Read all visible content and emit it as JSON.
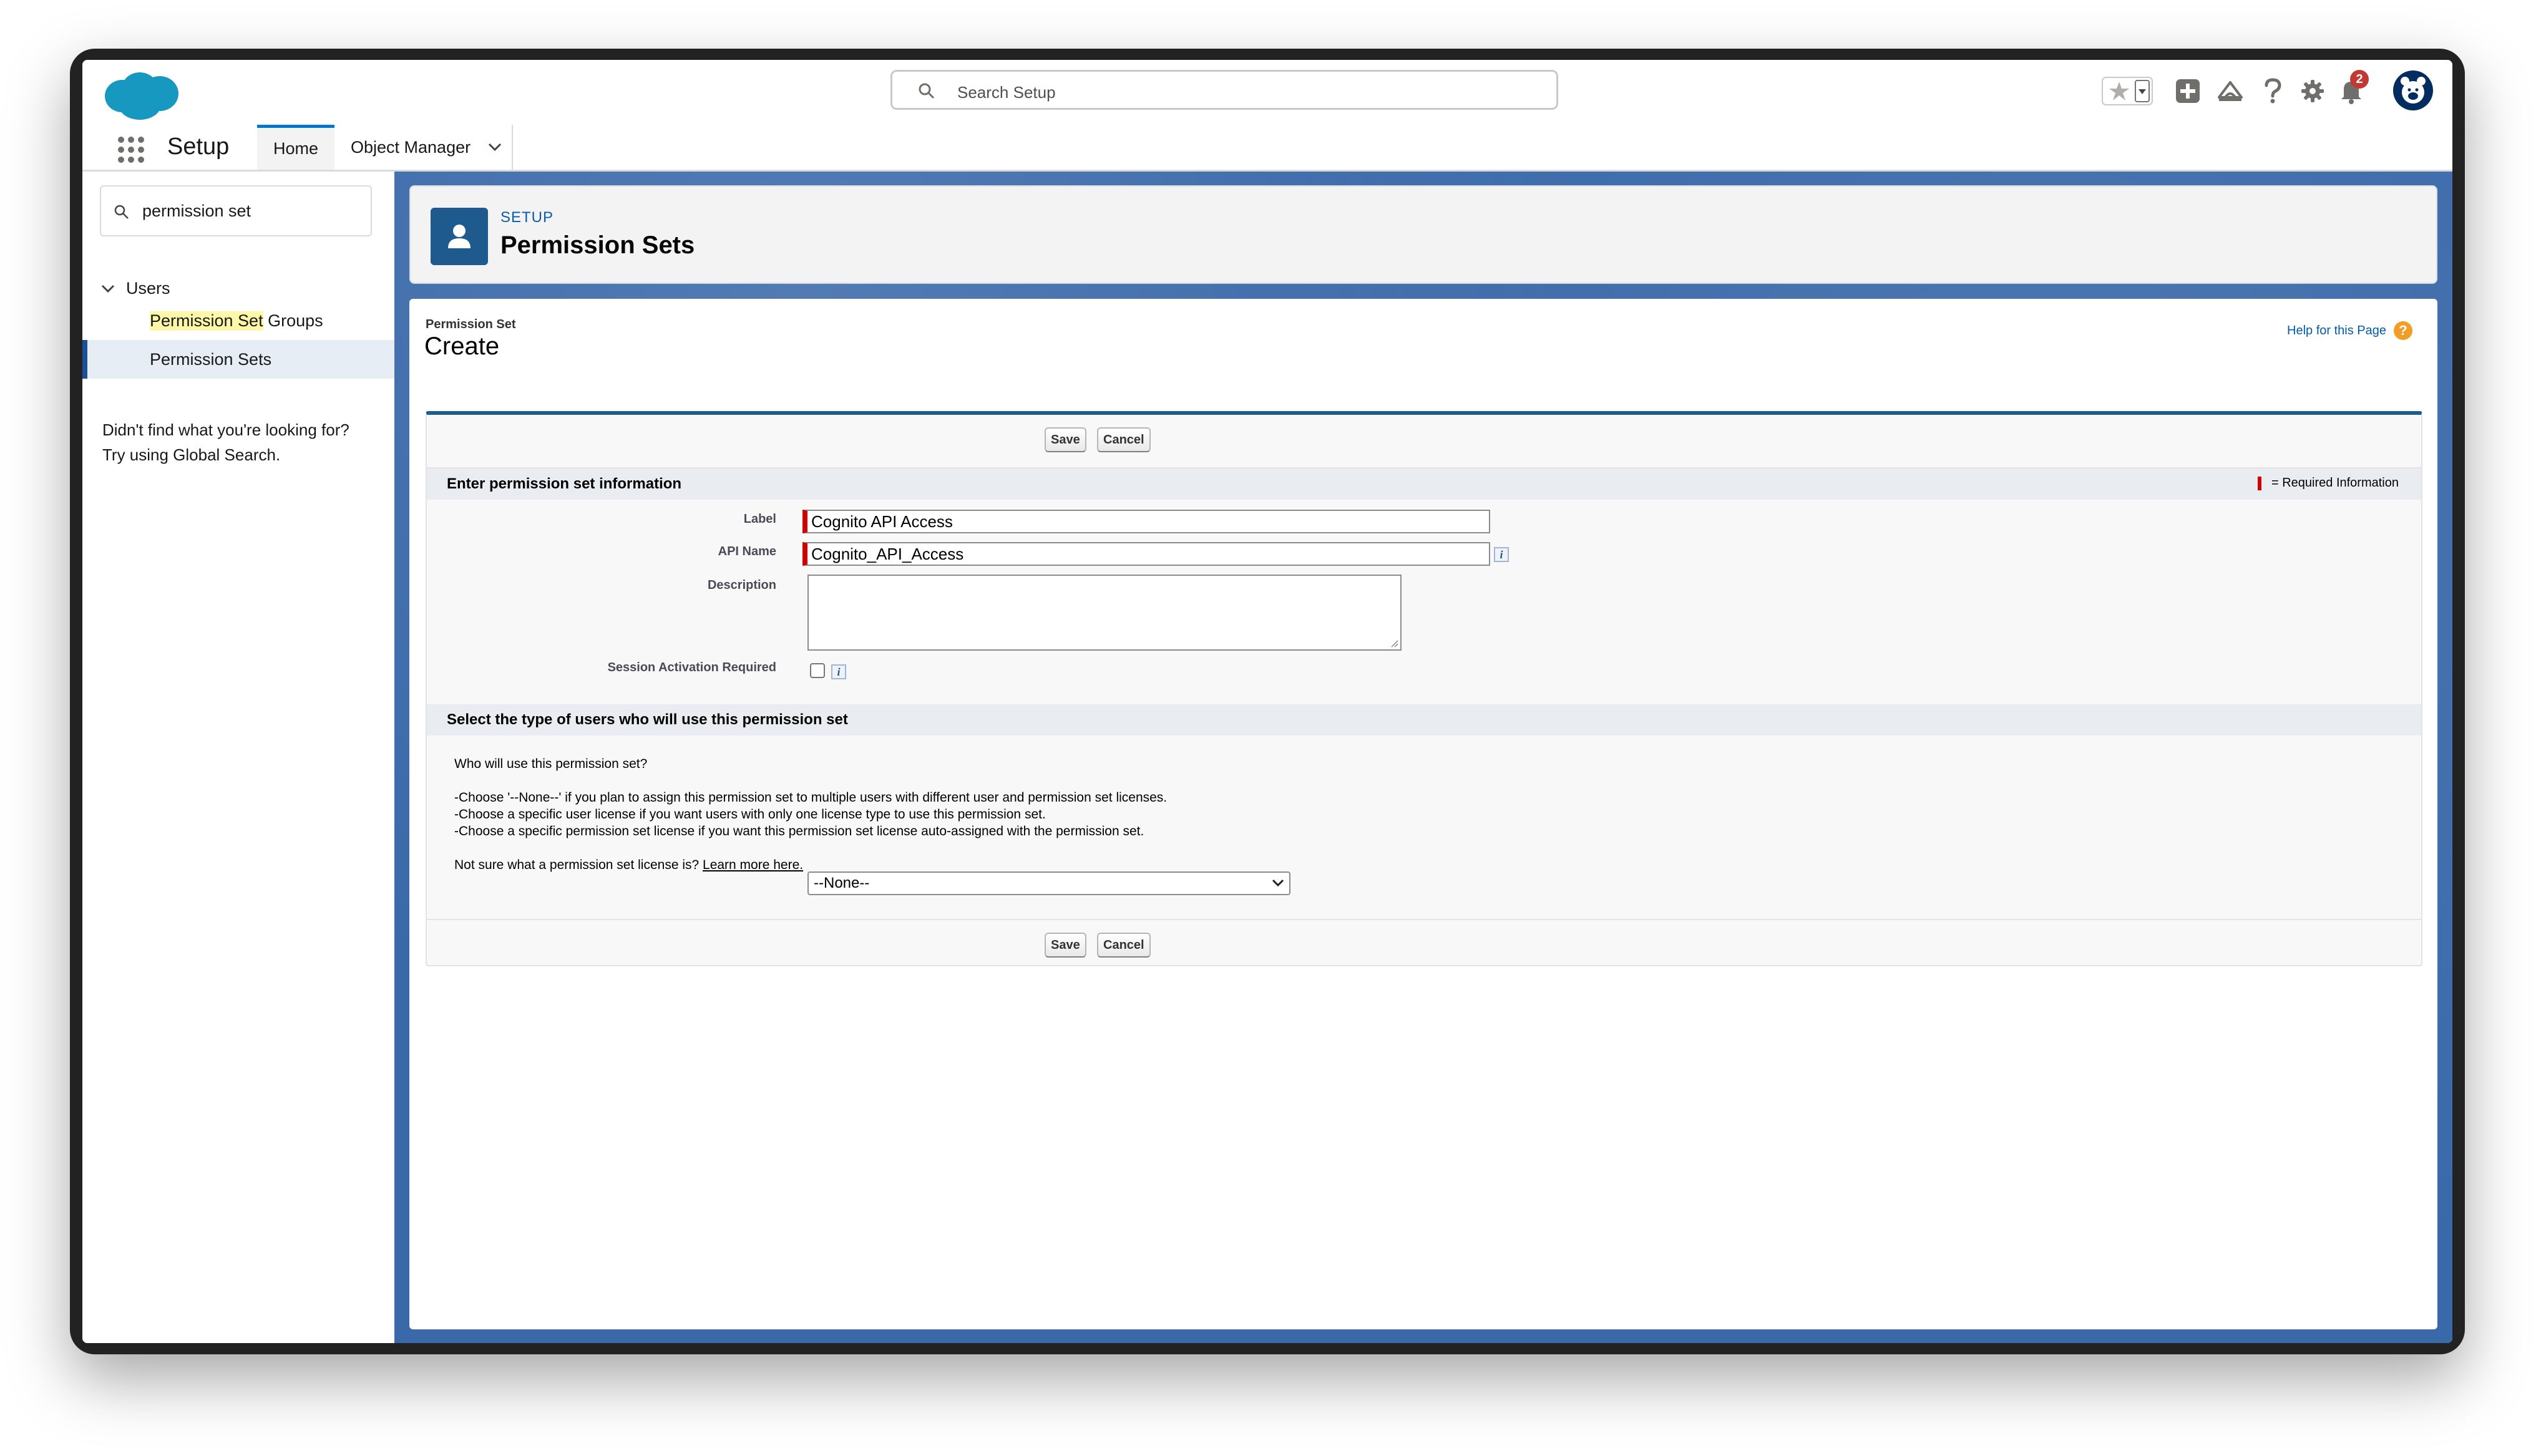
{
  "header": {
    "search_placeholder": "Search Setup",
    "notifications_count": "2"
  },
  "nav": {
    "app_name": "Setup",
    "tabs": [
      {
        "label": "Home"
      },
      {
        "label": "Object Manager"
      }
    ]
  },
  "sidebar": {
    "search_value": "permission set",
    "group_label": "Users",
    "items": [
      {
        "highlight": "Permission Set",
        "rest": " Groups"
      },
      {
        "label": "Permission Sets"
      }
    ],
    "not_found_line1": "Didn't find what you're looking for?",
    "not_found_line2": "Try using Global Search."
  },
  "page_header": {
    "kicker": "SETUP",
    "title": "Permission Sets"
  },
  "content": {
    "kicker": "Permission Set",
    "title": "Create",
    "help_link": "Help for this Page",
    "save_label": "Save",
    "cancel_label": "Cancel",
    "section1_title": "Enter permission set information",
    "required_legend": "= Required Information",
    "fields": {
      "label_label": "Label",
      "label_value": "Cognito API Access",
      "api_name_label": "API Name",
      "api_name_value": "Cognito_API_Access",
      "description_label": "Description",
      "session_label": "Session Activation Required"
    },
    "section2_title": "Select the type of users who will use this permission set",
    "question": "Who will use this permission set?",
    "bullets": [
      "-Choose '--None--' if you plan to assign this permission set to multiple users with different user and permission set licenses.",
      "-Choose a specific user license if you want users with only one license type to use this permission set.",
      "-Choose a specific permission set license if you want this permission set license auto-assigned with the permission set."
    ],
    "not_sure": "Not sure what a permission set license is?",
    "learn_more": "Learn more here.",
    "license_label": "License",
    "license_value": "--None--"
  }
}
